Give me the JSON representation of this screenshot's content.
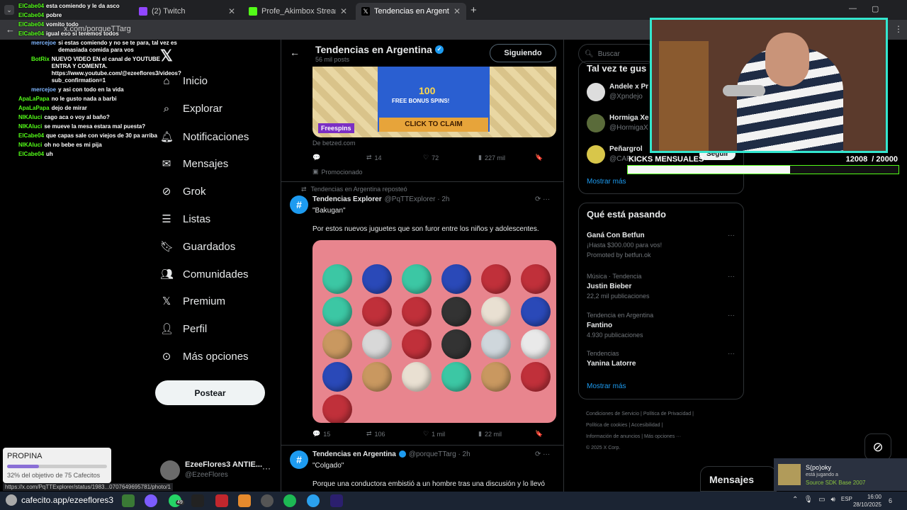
{
  "browser": {
    "tabs": [
      {
        "label": "(2) Twitch",
        "color": "#9146ff"
      },
      {
        "label": "Profe_Akimbox Stream - Watch",
        "color": "#53fc18"
      },
      {
        "label": "Tendencias en Argentina (@por",
        "color": "#ffffff"
      }
    ],
    "url": "x.com/porqueTTarg",
    "status_url": "https://x.com/PqTTExplorer/status/1983...0707649695781/photo/1"
  },
  "chat": [
    {
      "user": "ElCabe04",
      "msg": "esta comiendo y le da asco",
      "cls": "g"
    },
    {
      "user": "ElCabe04",
      "msg": "pobre",
      "cls": "g"
    },
    {
      "user": "ElCabe04",
      "msg": "vomito todo",
      "cls": "g"
    },
    {
      "user": "ElCabe04",
      "msg": "igual eso si tenemos todos",
      "cls": "g"
    },
    {
      "user": "mercejoe",
      "msg": "si estas comiendo y no se te para, tal vez es demasiada comida para vos",
      "cls": "o"
    },
    {
      "user": "BotRix",
      "msg": "NUEVO VIDEO EN el canal de YOUTUBE ENTRA Y COMENTA. https://www.youtube.com/@ezeeflores3/videos?sub_confirmation=1",
      "cls": "g"
    },
    {
      "user": "mercejoe",
      "msg": "y asi con todo en la vida",
      "cls": "o"
    },
    {
      "user": "ApaLaPapa",
      "msg": "no le gusto nada a barbi",
      "cls": "g"
    },
    {
      "user": "ApaLaPapa",
      "msg": "dejo de mirar",
      "cls": "g"
    },
    {
      "user": "NIKAluci",
      "msg": "cago aca o voy al baño?",
      "cls": "g"
    },
    {
      "user": "NIKAluci",
      "msg": "se mueve la mesa estara mal puesta?",
      "cls": "g"
    },
    {
      "user": "ElCabe04",
      "msg": "que capas sale con viejos de 30 pa arriba",
      "cls": "g"
    },
    {
      "user": "NIKAluci",
      "msg": "oh no bebe es mi pija",
      "cls": "g"
    },
    {
      "user": "ElCabe04",
      "msg": "uh",
      "cls": "g"
    }
  ],
  "nav": {
    "items": [
      "Inicio",
      "Explorar",
      "Notificaciones",
      "Mensajes",
      "Grok",
      "Listas",
      "Guardados",
      "Comunidades",
      "Premium",
      "Perfil",
      "Más opciones"
    ],
    "post_label": "Postear",
    "account_name": "EzeeFlores3 ANTIE...",
    "account_handle": "@EzeeFlores"
  },
  "header": {
    "title": "Tendencias en Argentina",
    "subtitle": "56 mil posts",
    "follow_label": "Siguiendo"
  },
  "ad": {
    "badge": "Freespins",
    "line1": "100",
    "line2": "FREE BONUS SPINS!",
    "cta": "CLICK TO CLAIM",
    "source": "De betzed.com",
    "retweets": "14",
    "likes": "72",
    "views": "227 mil",
    "promoted": "Promocionado"
  },
  "tweet1": {
    "reposted_by": "Tendencias en Argentina reposteó",
    "name": "Tendencias Explorer",
    "handle": "@PqTTExplorer · 2h",
    "quote": "\"Bakugan\"",
    "text": "Por estos nuevos juguetes que son furor entre los niños y adolescentes.",
    "replies": "15",
    "retweets": "106",
    "likes": "1 mil",
    "views": "22 mil"
  },
  "tweet2": {
    "name": "Tendencias en Argentina",
    "handle": "@porqueTTarg · 2h",
    "quote": "\"Colgado\"",
    "text": "Porque una conductora embistió a un hombre tras una discusión y lo llevó"
  },
  "right": {
    "search_placeholder": "Buscar",
    "who_title": "Tal vez te gus",
    "who": [
      {
        "name": "Andele x Pr",
        "handle": "@Xpndejo"
      },
      {
        "name": "Hormiga Xe",
        "handle": "@HormigaX"
      },
      {
        "name": "Peñargrol",
        "handle": "@CAP"
      }
    ],
    "follow_label": "Seguir",
    "show_more": "Mostrar más",
    "trending_title": "Qué está pasando",
    "trends": [
      {
        "top": "",
        "title": "Ganá Con Betfun",
        "bottom": "¡Hasta $300.000 para vos!",
        "extra": "Promoted by betfun.ok"
      },
      {
        "top": "Música · Tendencia",
        "title": "Justin Bieber",
        "bottom": "22,2 mil publicaciones",
        "extra": ""
      },
      {
        "top": "Tendencia en Argentina",
        "title": "Fantino",
        "bottom": "4.930 publicaciones",
        "extra": ""
      },
      {
        "top": "Tendencias",
        "title": "Yanina Latorre",
        "bottom": "",
        "extra": ""
      }
    ],
    "show_more2": "Mostrar más",
    "footer": [
      "Condiciones de Servicio",
      "Política de Privacidad",
      "Política de cookies",
      "Accesibilidad",
      "Información de anuncios",
      "Más opciones ···",
      "© 2025 X Corp."
    ]
  },
  "overlay": {
    "kicks_label": "KICKS MENSUALES",
    "kicks_value": "12008  / 20000",
    "kicks_progress": 0.6,
    "tip_title": "PROPINA",
    "tip_text": "32% del objetivo de 75 Cafecitos",
    "tip_progress": 0.32,
    "cafecito": "cafecito.app/ezeeflores3",
    "messages_label": "Mensajes",
    "playing_user": "S(po)oky",
    "playing_line": "está jugando a",
    "playing_game": "Source SDK Base 2007"
  },
  "taskbar": {
    "lang": "ESP",
    "time": "16:00",
    "date": "28/10/2025",
    "badge_whatsapp": "49",
    "notif": "6"
  }
}
